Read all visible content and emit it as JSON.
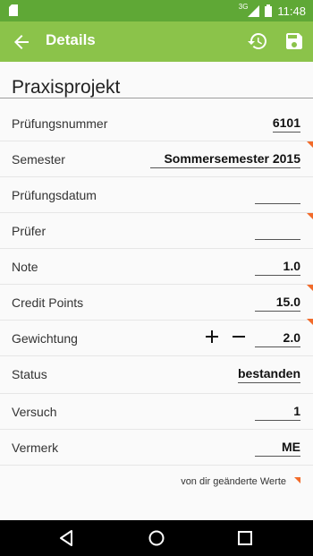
{
  "status_bar": {
    "network": "3G",
    "time": "11:48"
  },
  "app_bar": {
    "title": "Details"
  },
  "page": {
    "title": "Praxisprojekt"
  },
  "rows": [
    {
      "label": "Prüfungsnummer",
      "value": "6101",
      "changed": false
    },
    {
      "label": "Semester",
      "value": "Sommersemester 2015",
      "changed": true
    },
    {
      "label": "Prüfungsdatum",
      "value": "",
      "changed": false
    },
    {
      "label": "Prüfer",
      "value": "",
      "changed": true
    },
    {
      "label": "Note",
      "value": "1.0",
      "changed": false
    },
    {
      "label": "Credit Points",
      "value": "15.0",
      "changed": true
    },
    {
      "label": "Gewichtung",
      "value": "2.0",
      "changed": false
    },
    {
      "label": "Status",
      "value": "bestanden",
      "changed": false
    },
    {
      "label": "Versuch",
      "value": "1",
      "changed": false
    },
    {
      "label": "Vermerk",
      "value": "ME",
      "changed": false
    }
  ],
  "legend": {
    "text": "von dir geänderte Werte"
  },
  "colors": {
    "accent": "#8bc34a",
    "status_bar": "#5fa836",
    "changed_marker": "#f26b2a"
  },
  "icons": [
    "sd-card-icon",
    "signal-icon",
    "battery-icon",
    "back-arrow-icon",
    "history-icon",
    "save-icon",
    "plus-icon",
    "minus-icon",
    "nav-back-icon",
    "nav-home-icon",
    "nav-recents-icon"
  ]
}
